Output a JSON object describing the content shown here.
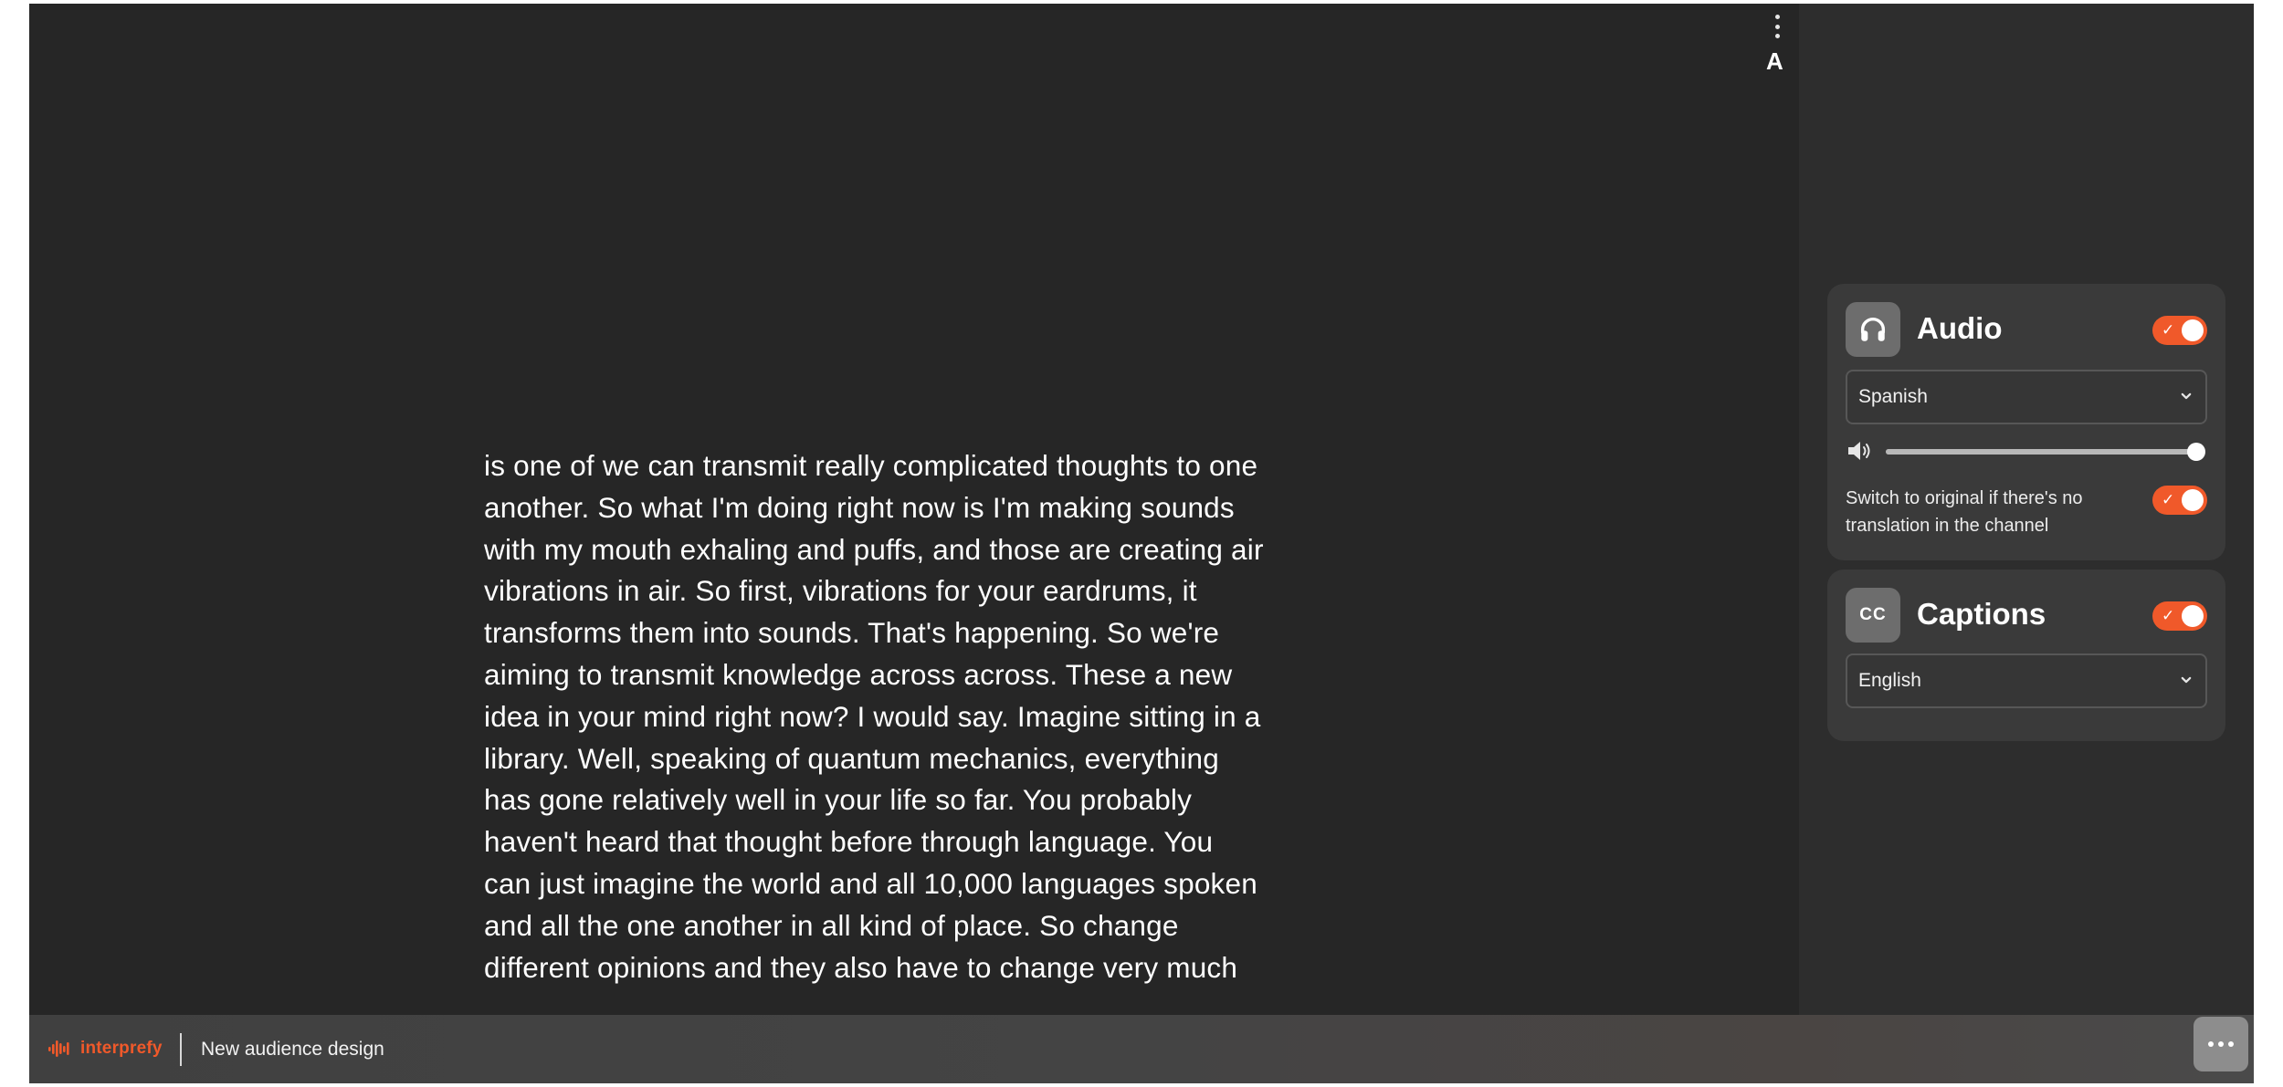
{
  "toolbar": {
    "font_size_label": "A"
  },
  "transcript": {
    "lines": [
      "is one of we can transmit really complicated thoughts to one",
      "another. So what I'm doing right now is I'm making sounds",
      "with my mouth exhaling and puffs, and those are creating air",
      "vibrations in air. So first, vibrations for your eardrums, it",
      "transforms them into sounds. That's happening. So we're",
      "aiming to transmit knowledge across across. These a new",
      "idea in your mind right now? I would say. Imagine sitting in a",
      "library. Well, speaking of quantum mechanics, everything",
      "has gone relatively well in your life so far. You probably",
      "haven't heard that thought before through language. You",
      "can just imagine the world and all 10,000 languages spoken",
      "and all the one another in all kind of place. So change",
      "different opinions and they also have to change very much"
    ]
  },
  "audio_panel": {
    "title": "Audio",
    "icon": "headphones-icon",
    "enabled": true,
    "language_selected": "Spanish",
    "volume_percent": 100,
    "switch_to_original_text": "Switch to original if there's no translation in the channel",
    "switch_to_original_enabled": true
  },
  "captions_panel": {
    "title": "Captions",
    "icon_text": "CC",
    "enabled": true,
    "language_selected": "English"
  },
  "footer": {
    "brand": "interprefy",
    "event_name": "New audience design"
  },
  "colors": {
    "accent": "#f0592a",
    "background": "#262626",
    "panel": "#3a3a3a"
  }
}
